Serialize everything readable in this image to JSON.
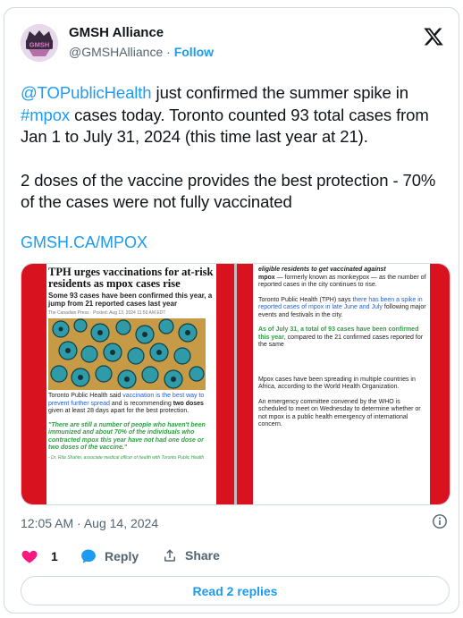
{
  "author": {
    "display_name": "GMSH Alliance",
    "handle": "@GMSHAlliance",
    "separator": "·",
    "follow_label": "Follow",
    "avatar_text": "GMSH"
  },
  "tweet": {
    "mention": "@TOPublicHealth",
    "line1_rest": " just confirmed the summer spike in ",
    "hashtag": "#mpox",
    "line1_tail": " cases today. Toronto counted 93 total cases from Jan 1 to July 31, 2024 (this time last year at 21).",
    "line2": "2 doses of the vaccine provides the best protection - 70% of the cases were not fully vaccinated",
    "link": "GMSH.CA/MPOX"
  },
  "media": {
    "left": {
      "title": "TPH urges vaccinations for at-risk residents as mpox cases rise",
      "subtitle": "Some 93 cases have been confirmed this year, a jump from 21 reported cases last year",
      "meta": "The Canadian Press · Posted: Aug 13, 2024 11:50 AM EDT",
      "p1_a": "Toronto Public Health said ",
      "p1_b": "vaccination is the best way to prevent further spread",
      "p1_c": " and is recommending ",
      "p1_d": "two doses",
      "p1_e": " given at least 28 days apart for the best protection.",
      "quote": "\"There are still a number of people who haven't been immunized and about 70% of the individuals who contracted mpox this year have not had one dose or two doses of the vaccine.\"",
      "attribution": "- Dr. Rita Shahin, associate medical officer of health with Toronto Public Health"
    },
    "right": {
      "p1_a": "eligible residents to get vaccinated against",
      "p1_b": "mpox",
      "p1_c": " — formerly known as monkeypox — as the number of reported cases in the city continues to rise.",
      "p2_a": "Toronto Public Health (TPH) says ",
      "p2_b": "there has been a spike in reported cases of mpox in late June and July",
      "p2_c": " following major events and festivals in the city.",
      "p3_a": "As of July 31, a total of 93 cases have been confirmed this year",
      "p3_b": ", compared to the 21 confirmed cases reported for the same",
      "p4": "Mpox cases have been spreading in multiple countries in Africa, according to the World Health Organization.",
      "p5": "An emergency committee convened by the WHO is scheduled to meet on Wednesday to determine whether or not mpox is a public health emergency of international concern."
    }
  },
  "footer": {
    "timestamp": "12:05 AM · Aug 14, 2024",
    "like_count": "1",
    "reply_label": "Reply",
    "share_label": "Share",
    "read_replies_label": "Read 2 replies"
  },
  "colors": {
    "link": "#1d9bf0",
    "like": "#f91880",
    "text": "#0f1419",
    "muted": "#536471",
    "accent_red": "#d9121f"
  },
  "icons": {
    "platform": "x-logo-icon",
    "like": "heart-icon",
    "reply": "speech-bubble-icon",
    "share": "share-upload-icon",
    "info": "info-icon"
  }
}
